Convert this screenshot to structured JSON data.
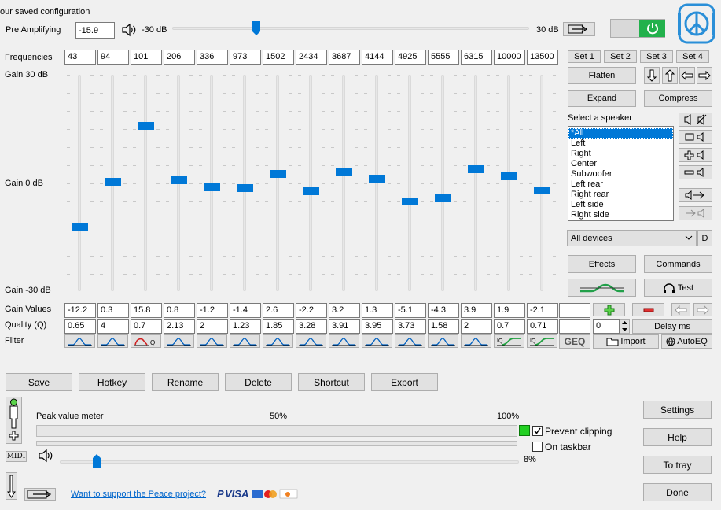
{
  "header": {
    "title": "our saved configuration",
    "pre_amp_label": "Pre Amplifying",
    "pre_amp_value": "-15.9",
    "min_db": "-30 dB",
    "max_db": "30 dB",
    "pre_amp_level": -15.9
  },
  "frequencies_label": "Frequencies",
  "frequencies": [
    "43",
    "94",
    "101",
    "206",
    "336",
    "973",
    "1502",
    "2434",
    "3687",
    "4144",
    "4925",
    "5555",
    "6315",
    "10000",
    "13500"
  ],
  "sets": [
    "Set 1",
    "Set 2",
    "Set 3",
    "Set 4"
  ],
  "gain_labels": {
    "top": "Gain 30 dB",
    "mid": "Gain 0 dB",
    "bottom": "Gain -30 dB"
  },
  "gains_label": "Gain Values",
  "gains": [
    "-12.2",
    "0.3",
    "15.8",
    "0.8",
    "-1.2",
    "-1.4",
    "2.6",
    "-2.2",
    "3.2",
    "1.3",
    "-5.1",
    "-4.3",
    "3.9",
    "1.9",
    "-2.1"
  ],
  "quality_label": "Quality (Q)",
  "quality": [
    "0.65",
    "4",
    "0.7",
    "2.13",
    "2",
    "1.23",
    "1.85",
    "3.28",
    "3.91",
    "3.95",
    "3.73",
    "1.58",
    "2",
    "0.7",
    "0.71"
  ],
  "filter_label": "Filter",
  "buttons": {
    "flatten": "Flatten",
    "expand": "Expand",
    "compress": "Compress",
    "effects": "Effects",
    "commands": "Commands",
    "test": "Test",
    "delay": "Delay ms",
    "delay_value": "0",
    "geq": "GEQ",
    "import": "Import",
    "autoeq": "AutoEQ",
    "save": "Save",
    "hotkey": "Hotkey",
    "rename": "Rename",
    "delete": "Delete",
    "shortcut": "Shortcut",
    "export": "Export",
    "settings": "Settings",
    "help": "Help",
    "to_tray": "To tray",
    "done": "Done",
    "device_d": "D",
    "midi": "MIDI"
  },
  "speaker": {
    "label": "Select a speaker",
    "items": [
      "*All",
      "Left",
      "Right",
      "Center",
      "Subwoofer",
      "Left rear",
      "Right rear",
      "Left side",
      "Right side"
    ],
    "selected": 0
  },
  "device": "All devices",
  "meter": {
    "label": "Peak value meter",
    "p50": "50%",
    "p100": "100%",
    "volume": "8%",
    "volume_level": 8
  },
  "checkboxes": {
    "prevent_clipping": "Prevent clipping",
    "prevent_checked": true,
    "on_taskbar": "On taskbar",
    "taskbar_checked": false
  },
  "support_link": "Want to support the Peace project?",
  "colors": {
    "accent": "#0078d7",
    "power": "#22b14c",
    "logo": "#2a8fd8"
  }
}
